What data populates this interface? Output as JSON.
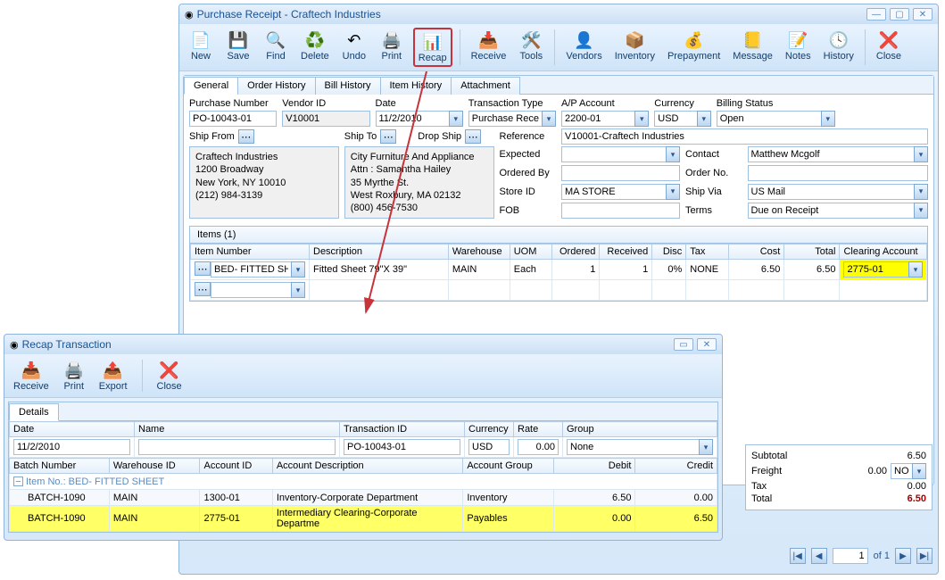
{
  "main_window": {
    "title": "Purchase Receipt - Craftech Industries",
    "toolbar": [
      {
        "label": "New",
        "icon": "📄"
      },
      {
        "label": "Save",
        "icon": "💾"
      },
      {
        "label": "Find",
        "icon": "🔍"
      },
      {
        "label": "Delete",
        "icon": "♻️"
      },
      {
        "label": "Undo",
        "icon": "↶"
      },
      {
        "label": "Print",
        "icon": "🖨️"
      },
      {
        "label": "Recap",
        "icon": "📊"
      },
      {
        "label": "Receive",
        "icon": "📥"
      },
      {
        "label": "Tools",
        "icon": "🛠️"
      },
      {
        "label": "Vendors",
        "icon": "👤"
      },
      {
        "label": "Inventory",
        "icon": "📦"
      },
      {
        "label": "Prepayment",
        "icon": "💰"
      },
      {
        "label": "Message",
        "icon": "📒"
      },
      {
        "label": "Notes",
        "icon": "📝"
      },
      {
        "label": "History",
        "icon": "🕓"
      },
      {
        "label": "Close",
        "icon": "❌"
      }
    ],
    "tabs": [
      "General",
      "Order History",
      "Bill History",
      "Item History",
      "Attachment"
    ],
    "form": {
      "labels": {
        "purchase_number": "Purchase Number",
        "vendor_id": "Vendor ID",
        "date": "Date",
        "transaction_type": "Transaction Type",
        "ap_account": "A/P Account",
        "currency": "Currency",
        "billing_status": "Billing Status",
        "ship_from": "Ship From",
        "ship_to": "Ship To",
        "drop_ship": "Drop Ship",
        "reference": "Reference",
        "expected": "Expected",
        "ordered_by": "Ordered By",
        "store_id": "Store ID",
        "fob": "FOB",
        "contact": "Contact",
        "order_no": "Order No.",
        "ship_via": "Ship Via",
        "terms": "Terms"
      },
      "purchase_number": "PO-10043-01",
      "vendor_id": "V10001",
      "date": "11/2/2010",
      "transaction_type": "Purchase Receipt",
      "ap_account": "2200-01",
      "currency": "USD",
      "billing_status": "Open",
      "reference": "V10001-Craftech Industries",
      "expected": "",
      "ordered_by": "",
      "store_id": "MA STORE",
      "fob": "",
      "contact": "Matthew Mcgolf",
      "order_no": "",
      "ship_via": "US Mail",
      "terms": "Due on Receipt",
      "ship_from_addr": "Craftech Industries\n1200 Broadway\nNew York, NY 10010\n(212) 984-3139",
      "ship_to_addr": "City Furniture And Appliance\nAttn : Samantha Hailey\n35 Myrthe St.\nWest Roxbury, MA 02132\n(800) 456-7530"
    },
    "items": {
      "tab_label": "Items (1)",
      "columns": [
        "Item Number",
        "Description",
        "Warehouse",
        "UOM",
        "Ordered",
        "Received",
        "Disc",
        "Tax",
        "Cost",
        "Total",
        "Clearing Account"
      ],
      "row": {
        "item_number": "BED- FITTED SHEE",
        "description": "Fitted Sheet 79\"X 39\"",
        "warehouse": "MAIN",
        "uom": "Each",
        "ordered": "1",
        "received": "1",
        "disc": "0%",
        "tax": "NONE",
        "cost": "6.50",
        "total": "6.50",
        "clearing": "2775-01"
      }
    },
    "totals": {
      "subtotal_label": "Subtotal",
      "subtotal": "6.50",
      "freight_label": "Freight",
      "freight": "0.00",
      "freight_opt": "NO",
      "tax_label": "Tax",
      "tax": "0.00",
      "total_label": "Total",
      "total": "6.50"
    },
    "pager": {
      "page": "1",
      "of_label": "of 1"
    }
  },
  "recap_window": {
    "title": "Recap Transaction",
    "toolbar": [
      {
        "label": "Receive",
        "icon": "📥"
      },
      {
        "label": "Print",
        "icon": "🖨️"
      },
      {
        "label": "Export",
        "icon": "📤"
      },
      {
        "label": "Close",
        "icon": "❌"
      }
    ],
    "details_tab": "Details",
    "header_labels": {
      "date": "Date",
      "name": "Name",
      "transaction_id": "Transaction ID",
      "currency": "Currency",
      "rate": "Rate",
      "group": "Group"
    },
    "header": {
      "date": "11/2/2010",
      "name": "",
      "transaction_id": "PO-10043-01",
      "currency": "USD",
      "rate": "0.00",
      "group": "None"
    },
    "columns": [
      "Batch Number",
      "Warehouse ID",
      "Account ID",
      "Account Description",
      "Account Group",
      "Debit",
      "Credit"
    ],
    "category_row": "Item No.: BED- FITTED SHEET",
    "rows": [
      {
        "batch": "BATCH-1090",
        "wh": "MAIN",
        "acct": "1300-01",
        "desc": "Inventory-Corporate Department",
        "group": "Inventory",
        "debit": "6.50",
        "credit": "0.00"
      },
      {
        "batch": "BATCH-1090",
        "wh": "MAIN",
        "acct": "2775-01",
        "desc": "Intermediary Clearing-Corporate Departme",
        "group": "Payables",
        "debit": "0.00",
        "credit": "6.50"
      }
    ]
  }
}
